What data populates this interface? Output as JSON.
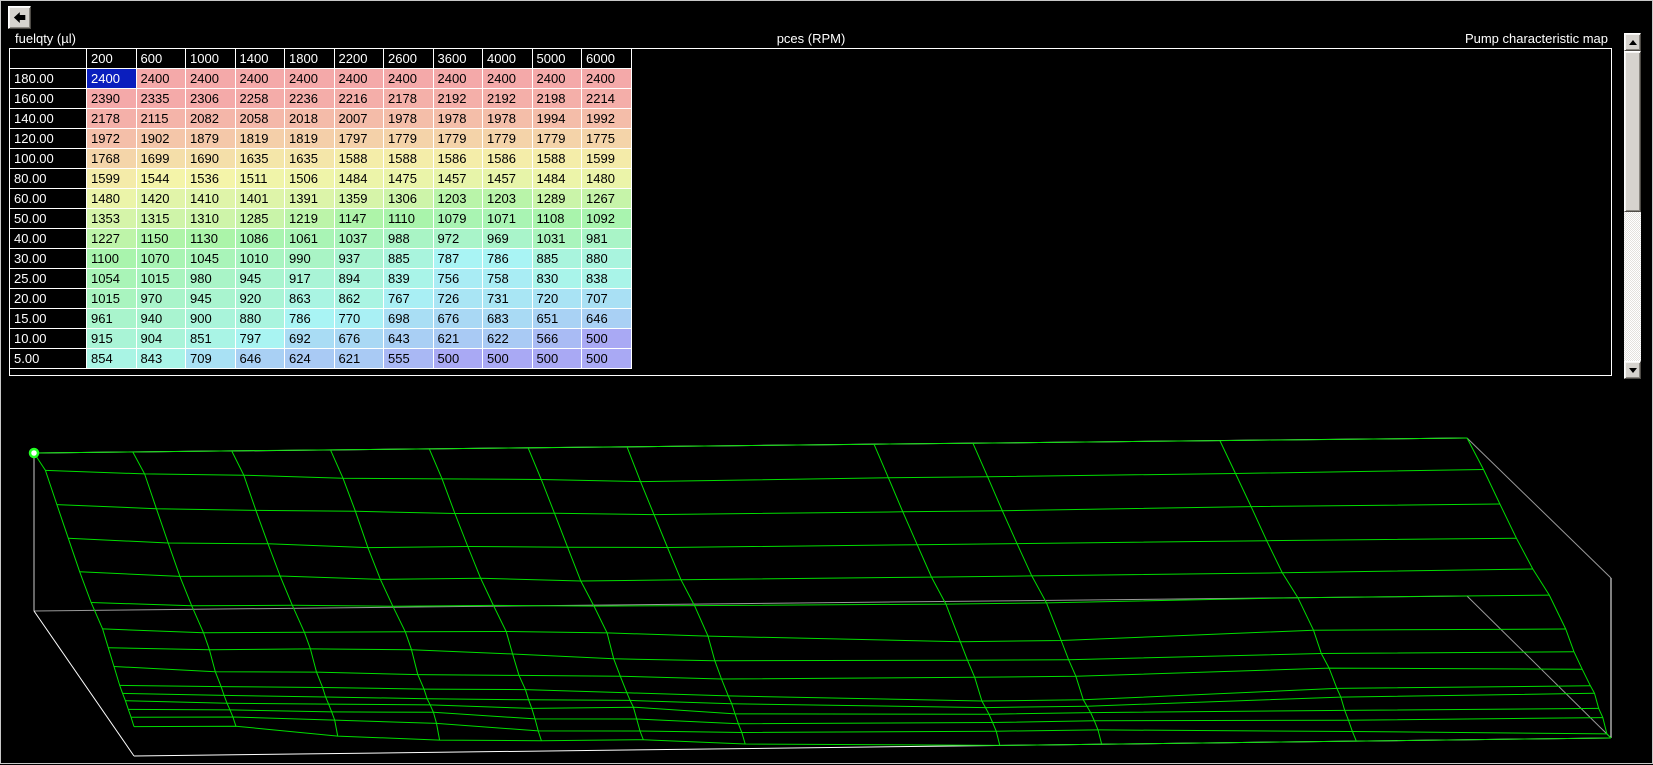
{
  "labels": {
    "y_axis": "fuelqty (µl)",
    "x_axis": "pces (RPM)",
    "title": "Pump characteristic map"
  },
  "icons": {
    "back": "left-arrow",
    "scroll_up": "triangle-up",
    "scroll_down": "triangle-down",
    "selected_point": "green-ring-white-dot"
  },
  "chart_data": {
    "type": "heatmap",
    "title": "Pump characteristic map",
    "x_axis": {
      "label": "pces (RPM)",
      "ticks": [
        200,
        600,
        1000,
        1400,
        1800,
        2200,
        2600,
        3600,
        4000,
        5000,
        6000
      ]
    },
    "y_axis": {
      "label": "fuelqty (µl)",
      "ticks": [
        "180.00",
        "160.00",
        "140.00",
        "120.00",
        "100.00",
        "80.00",
        "60.00",
        "50.00",
        "40.00",
        "30.00",
        "25.00",
        "20.00",
        "15.00",
        "10.00",
        "5.00"
      ]
    },
    "value_range": [
      500,
      2400
    ],
    "values": [
      [
        2400,
        2400,
        2400,
        2400,
        2400,
        2400,
        2400,
        2400,
        2400,
        2400,
        2400
      ],
      [
        2390,
        2335,
        2306,
        2258,
        2236,
        2216,
        2178,
        2192,
        2192,
        2198,
        2214
      ],
      [
        2178,
        2115,
        2082,
        2058,
        2018,
        2007,
        1978,
        1978,
        1978,
        1994,
        1992
      ],
      [
        1972,
        1902,
        1879,
        1819,
        1819,
        1797,
        1779,
        1779,
        1779,
        1779,
        1775
      ],
      [
        1768,
        1699,
        1690,
        1635,
        1635,
        1588,
        1588,
        1586,
        1586,
        1588,
        1599
      ],
      [
        1599,
        1544,
        1536,
        1511,
        1506,
        1484,
        1475,
        1457,
        1457,
        1484,
        1480
      ],
      [
        1480,
        1420,
        1410,
        1401,
        1391,
        1359,
        1306,
        1203,
        1203,
        1289,
        1267
      ],
      [
        1353,
        1315,
        1310,
        1285,
        1219,
        1147,
        1110,
        1079,
        1071,
        1108,
        1092
      ],
      [
        1227,
        1150,
        1130,
        1086,
        1061,
        1037,
        988,
        972,
        969,
        1031,
        981
      ],
      [
        1100,
        1070,
        1045,
        1010,
        990,
        937,
        885,
        787,
        786,
        885,
        880
      ],
      [
        1054,
        1015,
        980,
        945,
        917,
        894,
        839,
        756,
        758,
        830,
        838
      ],
      [
        1015,
        970,
        945,
        920,
        863,
        862,
        767,
        726,
        731,
        720,
        707
      ],
      [
        961,
        940,
        900,
        880,
        786,
        770,
        698,
        676,
        683,
        651,
        646
      ],
      [
        915,
        904,
        851,
        797,
        692,
        676,
        643,
        621,
        622,
        566,
        500
      ],
      [
        854,
        843,
        709,
        646,
        624,
        621,
        555,
        500,
        500,
        500,
        500
      ]
    ],
    "selected_cell": {
      "row_label": "180.00",
      "column": 200,
      "value": 2400,
      "row_index": 0,
      "col_index": 0
    },
    "legend_position": "none",
    "grid": true,
    "colors": {
      "selection_bg": "#0a1ebe",
      "selection_text": "#ffffff",
      "heat_high": "#f5a8ac",
      "heat_mid": "#b9f0b0",
      "heat_low": "#b0aef2",
      "mesh_green": "#00dd00",
      "box_edge_white": "#ffffff",
      "box_edge_gray": "#999999",
      "background": "#000000"
    }
  }
}
